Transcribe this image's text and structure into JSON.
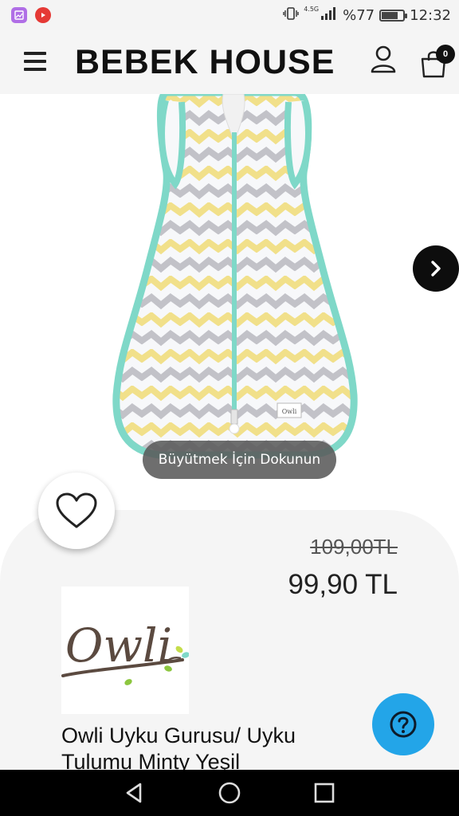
{
  "status_bar": {
    "network_type": "4.5G",
    "battery": "%77",
    "battery_level": 0.77,
    "time": "12:32",
    "icons": [
      "gallery-app-icon",
      "youtube-icon",
      "vibrate-icon",
      "signal-icon",
      "battery-icon"
    ]
  },
  "header": {
    "brand": "BEBEK HOUSE",
    "cart_count": "0",
    "icons": [
      "menu-icon",
      "user-icon",
      "cart-icon"
    ]
  },
  "gallery": {
    "zoom_hint": "Büyütmek İçin Dokunun",
    "label_on_product": "Owli"
  },
  "product": {
    "old_price": "109,00TL",
    "price": "99,90 TL",
    "brand_logo_text": "Owli",
    "name": "Owli Uyku Gurusu/ Uyku Tulumu Minty Yeşil"
  },
  "colors": {
    "accent_mint": "#7fd8c8",
    "stripe_yellow": "#f1e08a",
    "stripe_grey": "#c2c2c8",
    "help_blue": "#23a5e8",
    "logo_brown": "#5b4a40"
  },
  "nav": {
    "icons": [
      "back-icon",
      "home-icon",
      "recents-icon"
    ]
  }
}
